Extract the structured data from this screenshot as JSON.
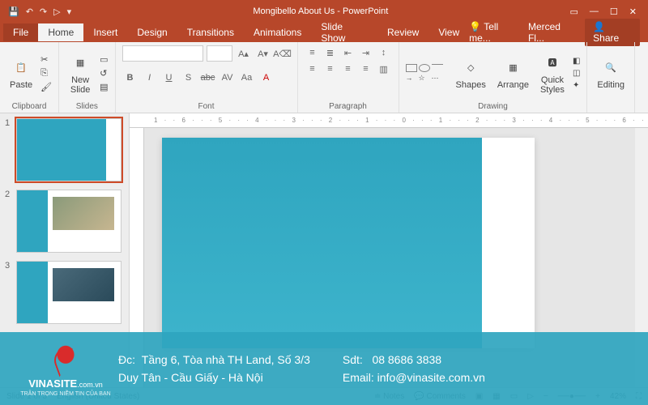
{
  "titlebar": {
    "title": "Mongibello About Us - PowerPoint"
  },
  "menu": {
    "file": "File",
    "home": "Home",
    "insert": "Insert",
    "design": "Design",
    "transitions": "Transitions",
    "animations": "Animations",
    "slideshow": "Slide Show",
    "review": "Review",
    "view": "View",
    "tellme": "Tell me...",
    "user": "Merced Fl...",
    "share": "Share"
  },
  "ribbon": {
    "paste": "Paste",
    "clipboard": "Clipboard",
    "newslide": "New\nSlide",
    "slides": "Slides",
    "font_group": "Font",
    "para_group": "Paragraph",
    "shapes": "Shapes",
    "arrange": "Arrange",
    "quickstyles": "Quick\nStyles",
    "drawing": "Drawing",
    "editing": "Editing",
    "bold": "B",
    "italic": "I",
    "underline": "U",
    "strike": "abc",
    "av": "AV"
  },
  "ruler": "1 · · 6 · · · 5 · · · 4 · · · 3 · · · 2 · · · 1 · · · 0 · · · 1 · · · 2 · · · 3 · · · 4 · · · 5 · · · 6 · ·",
  "thumbs": {
    "n1": "1",
    "n2": "2",
    "n3": "3"
  },
  "status": {
    "slide": "Slide 1 of 3",
    "lang": "English (United States)",
    "notes": "Notes",
    "comments": "Comments",
    "zoom": "42%"
  },
  "overlay": {
    "logo_text": "VINASITE",
    "logo_suffix": ".com.vn",
    "logo_tag": "TRÂN TRỌNG NIỀM TIN CỦA BẠN",
    "addr_label": "Đc:",
    "addr1": "Tầng 6, Tòa nhà TH Land, Số 3/3",
    "addr2": "Duy Tân - Cầu Giấy - Hà Nội",
    "phone_label": "Sdt:",
    "phone": "08 8686 3838",
    "email_label": "Email:",
    "email": "info@vinasite.com.vn"
  }
}
